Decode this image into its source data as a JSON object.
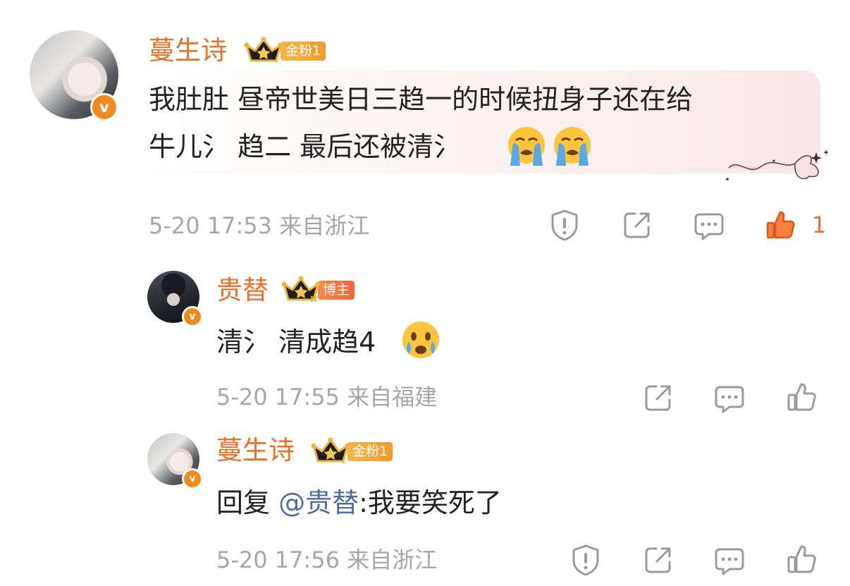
{
  "comments": [
    {
      "username": "蔓生诗",
      "badge_label": "金粉1",
      "badge_level": "I",
      "text_line1": "我肚肚 昼帝世美日三趋一的时候扭身子还在给",
      "text_line2": "牛儿氵 趋二 最后还被清氵",
      "meta": "5-20 17:53 来自浙江",
      "like_count": "1",
      "avatar_icon": "verified-v-icon",
      "emojis": [
        "loudly-crying-emoji",
        "loudly-crying-emoji"
      ]
    },
    {
      "username": "贵替",
      "badge_label": "博主",
      "badge_level": "II",
      "text": "清氵 清成趋4",
      "meta": "5-20 17:55 来自福建",
      "emojis": [
        "crying-face-emoji"
      ]
    },
    {
      "username": "蔓生诗",
      "badge_label": "金粉1",
      "badge_level": "I",
      "reply_prefix": "回复",
      "mention": "@贵替",
      "text": ":我要笑死了",
      "meta": "5-20 17:56 来自浙江"
    }
  ],
  "colors": {
    "name": "#ea7025",
    "like_active": "#f26a2e",
    "gray": "#a6a6a6",
    "mention": "#4d6da2",
    "bubble": "#fbeff0"
  },
  "verified_mark": "v"
}
